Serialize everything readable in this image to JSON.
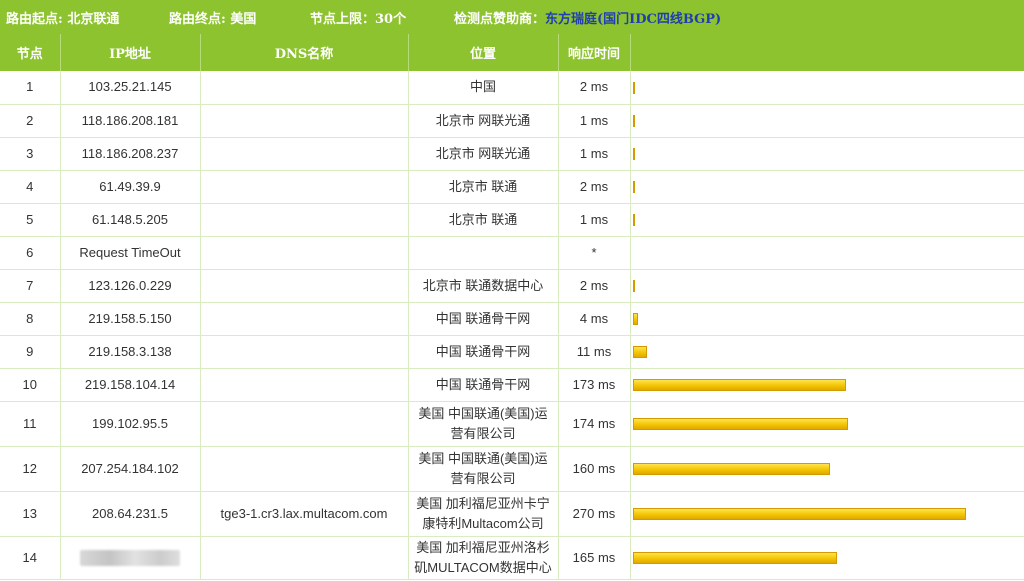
{
  "header": {
    "route_start": "路由起点: 北京联通",
    "route_end": "路由终点: 美国",
    "node_limit": "节点上限：30个",
    "sponsor_label": "检测点赞助商：",
    "sponsor_name": "东方瑞庭",
    "sponsor_link": "(国门IDC四线BGP)"
  },
  "table": {
    "columns": [
      "节点",
      "IP地址",
      "DNS名称",
      "位置",
      "响应时间",
      ""
    ],
    "max_ms": 270,
    "rows": [
      {
        "node": "1",
        "ip": "103.25.21.145",
        "dns": "",
        "loc": "中国",
        "time": "2 ms",
        "ms": 2
      },
      {
        "node": "2",
        "ip": "118.186.208.181",
        "dns": "",
        "loc": "北京市 网联光通",
        "time": "1 ms",
        "ms": 1
      },
      {
        "node": "3",
        "ip": "118.186.208.237",
        "dns": "",
        "loc": "北京市 网联光通",
        "time": "1 ms",
        "ms": 1
      },
      {
        "node": "4",
        "ip": "61.49.39.9",
        "dns": "",
        "loc": "北京市 联通",
        "time": "2 ms",
        "ms": 2
      },
      {
        "node": "5",
        "ip": "61.148.5.205",
        "dns": "",
        "loc": "北京市 联通",
        "time": "1 ms",
        "ms": 1
      },
      {
        "node": "6",
        "ip": "Request TimeOut",
        "dns": "",
        "loc": "",
        "time": "*",
        "ms": 0
      },
      {
        "node": "7",
        "ip": "123.126.0.229",
        "dns": "",
        "loc": "北京市 联通数据中心",
        "time": "2 ms",
        "ms": 2
      },
      {
        "node": "8",
        "ip": "219.158.5.150",
        "dns": "",
        "loc": "中国 联通骨干网",
        "time": "4 ms",
        "ms": 4
      },
      {
        "node": "9",
        "ip": "219.158.3.138",
        "dns": "",
        "loc": "中国 联通骨干网",
        "time": "11 ms",
        "ms": 11
      },
      {
        "node": "10",
        "ip": "219.158.104.14",
        "dns": "",
        "loc": "中国 联通骨干网",
        "time": "173 ms",
        "ms": 173
      },
      {
        "node": "11",
        "ip": "199.102.95.5",
        "dns": "",
        "loc": "美国 中国联通(美国)运营有限公司",
        "time": "174 ms",
        "ms": 174
      },
      {
        "node": "12",
        "ip": "207.254.184.102",
        "dns": "",
        "loc": "美国 中国联通(美国)运营有限公司",
        "time": "160 ms",
        "ms": 160
      },
      {
        "node": "13",
        "ip": "208.64.231.5",
        "dns": "tge3-1.cr3.lax.multacom.com",
        "loc": "美国 加利福尼亚州卡宁康特利Multacom公司",
        "time": "270 ms",
        "ms": 270
      },
      {
        "node": "14",
        "ip": "",
        "dns": "",
        "loc": "美国 加利福尼亚州洛杉矶MULTACOM数据中心",
        "time": "165 ms",
        "ms": 165
      }
    ]
  }
}
